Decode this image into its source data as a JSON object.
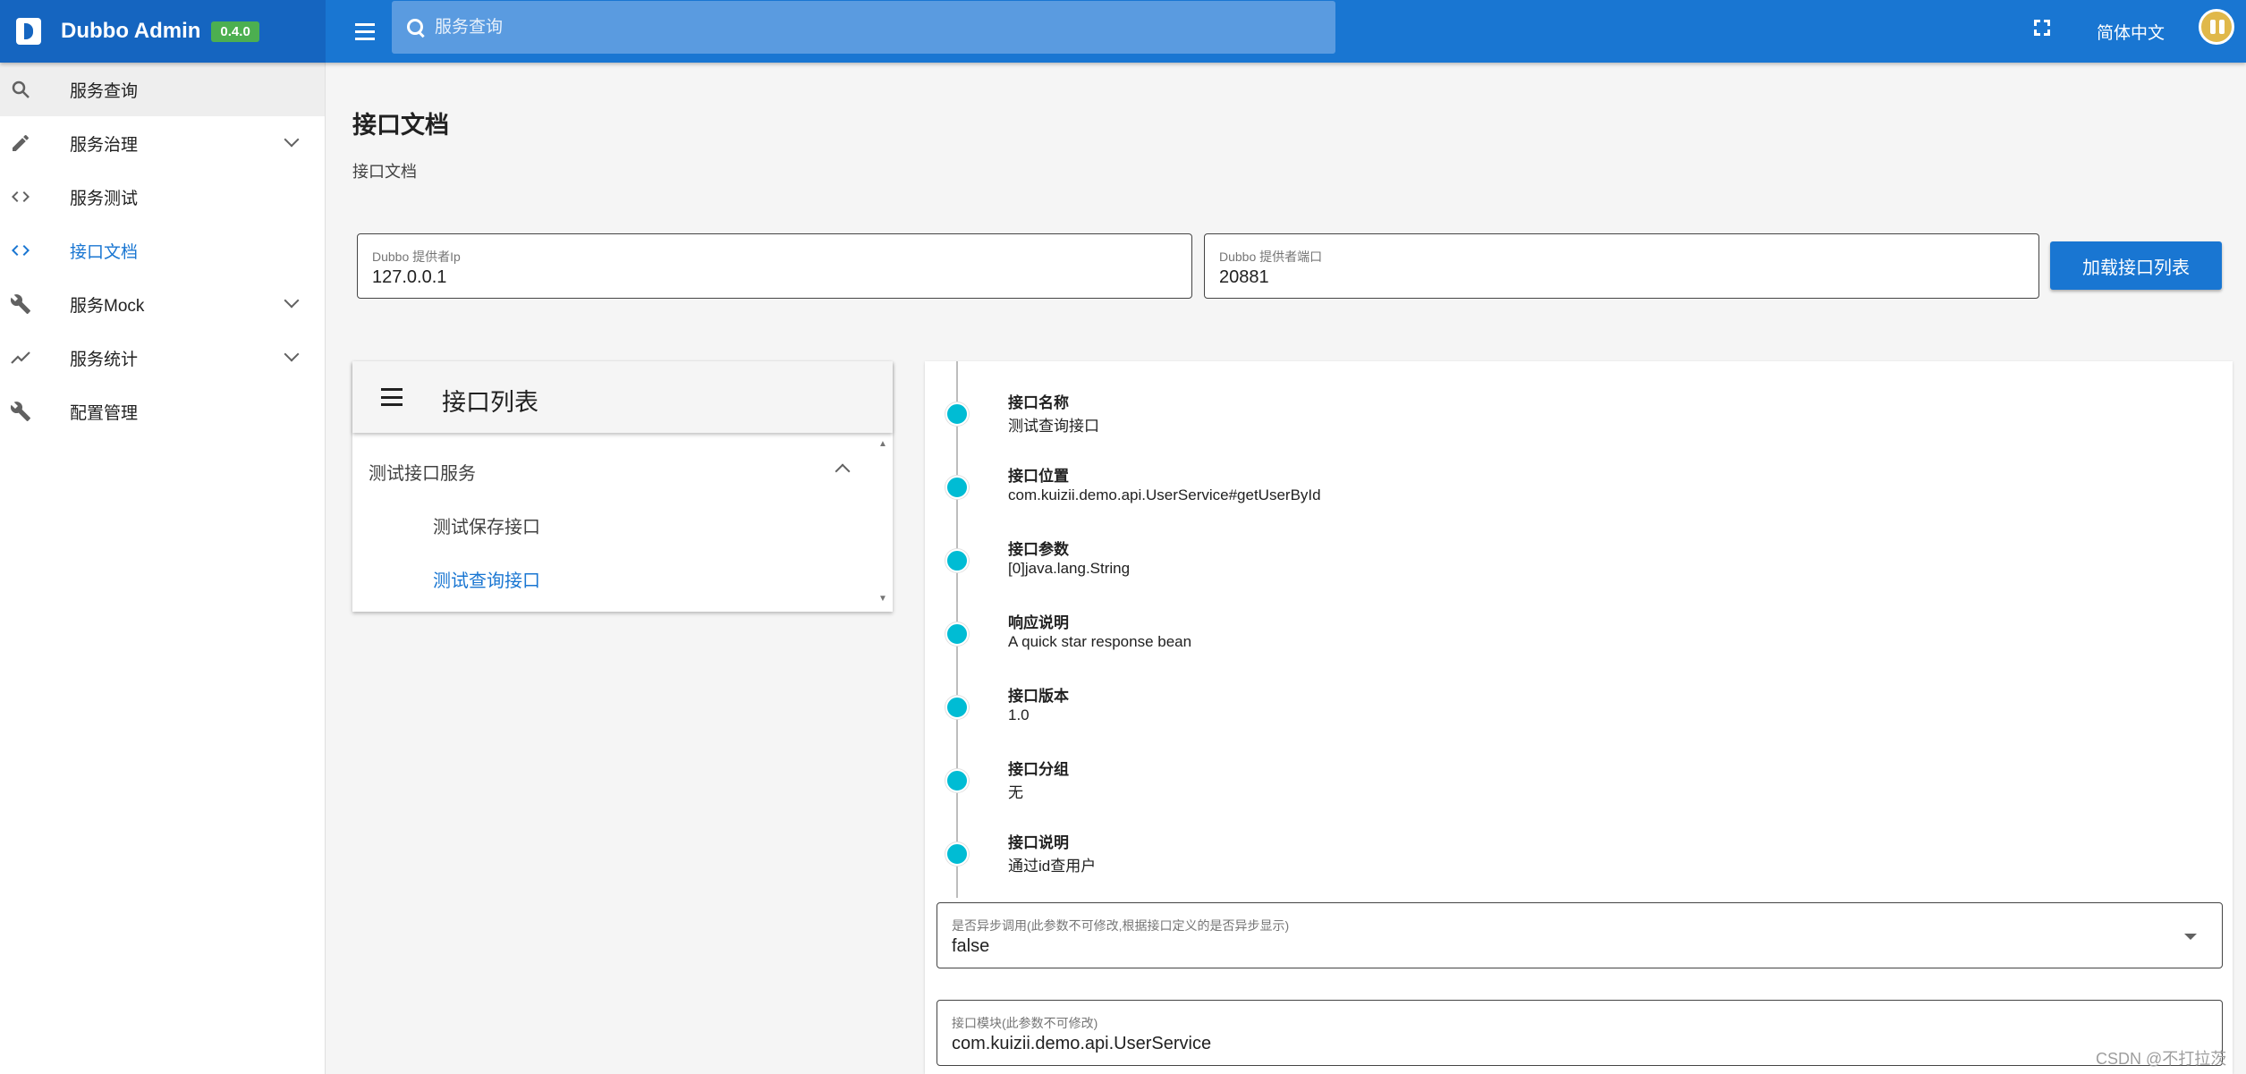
{
  "app": {
    "title": "Dubbo Admin",
    "version": "0.4.0",
    "brand_color": "#1565c0",
    "topbar_color": "#1976d2"
  },
  "topbar": {
    "search_placeholder": "服务查询",
    "language": "简体中文"
  },
  "sidebar": {
    "items": [
      {
        "label": "服务查询",
        "icon": "search-icon",
        "expandable": false
      },
      {
        "label": "服务治理",
        "icon": "pencil-icon",
        "expandable": true
      },
      {
        "label": "服务测试",
        "icon": "code-icon",
        "expandable": false
      },
      {
        "label": "接口文档",
        "icon": "code-icon",
        "expandable": false,
        "active": true
      },
      {
        "label": "服务Mock",
        "icon": "wrench-icon",
        "expandable": true
      },
      {
        "label": "服务统计",
        "icon": "trending-icon",
        "expandable": true
      },
      {
        "label": "配置管理",
        "icon": "wrench-icon",
        "expandable": false
      }
    ]
  },
  "page": {
    "title": "接口文档",
    "breadcrumb": "接口文档"
  },
  "form": {
    "ip_label": "Dubbo 提供者Ip",
    "ip_value": "127.0.0.1",
    "port_label": "Dubbo 提供者端口",
    "port_value": "20881",
    "load_button": "加载接口列表"
  },
  "interface_list": {
    "title": "接口列表",
    "group": "测试接口服务",
    "items": [
      {
        "label": "测试保存接口",
        "active": false
      },
      {
        "label": "测试查询接口",
        "active": true
      }
    ]
  },
  "detail": {
    "entries": [
      {
        "title": "接口名称",
        "value": "测试查询接口"
      },
      {
        "title": "接口位置",
        "value": "com.kuizii.demo.api.UserService#getUserById"
      },
      {
        "title": "接口参数",
        "value": "[0]java.lang.String"
      },
      {
        "title": "响应说明",
        "value": "A quick star response bean"
      },
      {
        "title": "接口版本",
        "value": "1.0"
      },
      {
        "title": "接口分组",
        "value": "无"
      },
      {
        "title": "接口说明",
        "value": "通过id查用户"
      }
    ],
    "timeline_color": "#00bcd4",
    "async_label": "是否异步调用(此参数不可修改,根据接口定义的是否异步显示)",
    "async_value": "false",
    "module_label": "接口模块(此参数不可修改)",
    "module_value": "com.kuizii.demo.api.UserService"
  },
  "watermark": "CSDN @不打拉茨"
}
